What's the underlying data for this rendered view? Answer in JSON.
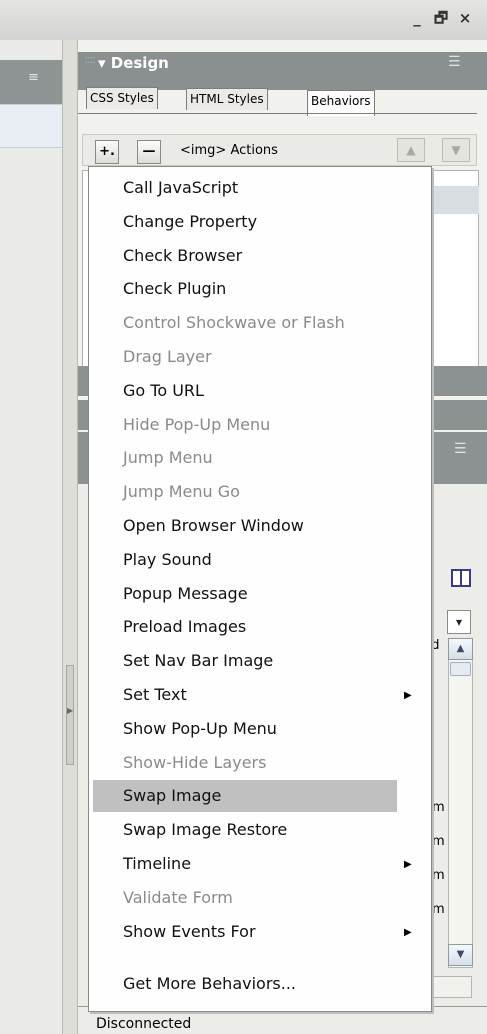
{
  "window": {
    "minimize_icon": "minimize-icon",
    "restore_icon": "restore-icon",
    "close_icon": "close-icon",
    "minimize_glyph": "_",
    "restore_glyph": "🗗",
    "close_glyph": "×"
  },
  "design_panel": {
    "title": "▾ Design",
    "tabs": [
      "CSS Styles",
      "HTML Styles",
      "Behaviors"
    ],
    "active_tab": "Behaviors"
  },
  "toolbar": {
    "add_label": "+.",
    "remove_label": "—",
    "actions_label": "<img> Actions",
    "up_label": "▲",
    "down_label": "▼"
  },
  "menu": {
    "items": [
      {
        "label": "Call JavaScript",
        "enabled": true
      },
      {
        "label": "Change Property",
        "enabled": true
      },
      {
        "label": "Check Browser",
        "enabled": true
      },
      {
        "label": "Check Plugin",
        "enabled": true
      },
      {
        "label": "Control Shockwave or Flash",
        "enabled": false
      },
      {
        "label": "Drag Layer",
        "enabled": false
      },
      {
        "label": "Go To URL",
        "enabled": true
      },
      {
        "label": "Hide Pop-Up Menu",
        "enabled": false
      },
      {
        "label": "Jump Menu",
        "enabled": false
      },
      {
        "label": "Jump Menu Go",
        "enabled": false
      },
      {
        "label": "Open Browser Window",
        "enabled": true
      },
      {
        "label": "Play Sound",
        "enabled": true
      },
      {
        "label": "Popup Message",
        "enabled": true
      },
      {
        "label": "Preload Images",
        "enabled": true
      },
      {
        "label": "Set Nav Bar Image",
        "enabled": true
      },
      {
        "label": "Set Text",
        "enabled": true,
        "submenu": true
      },
      {
        "label": "Show Pop-Up Menu",
        "enabled": true
      },
      {
        "label": "Show-Hide Layers",
        "enabled": false
      },
      {
        "label": "Swap Image",
        "enabled": true,
        "highlighted": true
      },
      {
        "label": "Swap Image Restore",
        "enabled": true
      },
      {
        "label": "Timeline",
        "enabled": true,
        "submenu": true
      },
      {
        "label": "Validate Form",
        "enabled": false
      }
    ],
    "show_events_for": "Show Events For",
    "get_more": "Get More Behaviors...",
    "submenu_glyph": "▶"
  },
  "properties": {
    "column_partial": "nd",
    "row_marks": [
      "m",
      "m",
      "m",
      "m"
    ],
    "dropdown_glyph": "▾",
    "scroll_up": "▲",
    "scroll_down": "▼"
  },
  "status": {
    "text": "Disconnected"
  },
  "colors": {
    "panel_header": "#8a9090",
    "highlight": "#c0c0c0",
    "disabled_text": "#8a8a8a"
  }
}
